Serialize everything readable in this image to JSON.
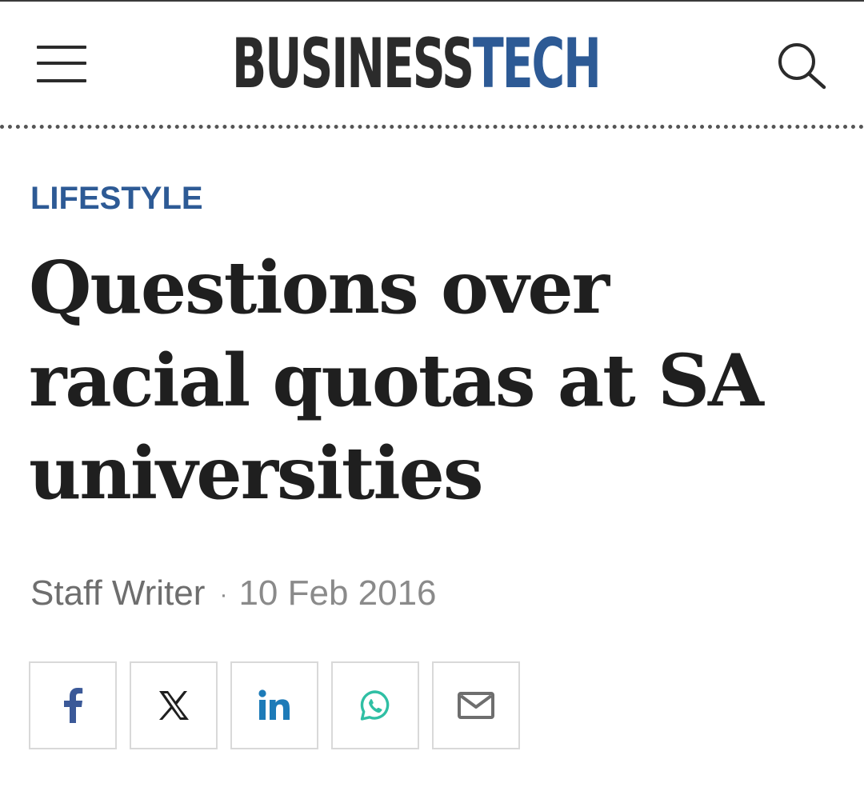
{
  "header": {
    "logo_part1": "BUSINESS",
    "logo_part2": "TECH",
    "menu_icon": "hamburger-menu-icon",
    "search_icon": "search-icon"
  },
  "article": {
    "category": "LIFESTYLE",
    "headline": "Questions over racial quotas at SA universities",
    "author": "Staff Writer",
    "separator": "·",
    "date": "10 Feb 2016"
  },
  "share": {
    "buttons": [
      {
        "icon": "facebook-icon",
        "color": "#3b5998"
      },
      {
        "icon": "x-twitter-icon",
        "color": "#1f1f1f"
      },
      {
        "icon": "linkedin-icon",
        "color": "#1d7bb8"
      },
      {
        "icon": "whatsapp-icon",
        "color": "#2fbfa4"
      },
      {
        "icon": "email-icon",
        "color": "#6e6e6e"
      }
    ]
  },
  "colors": {
    "brand_blue": "#2d5a95",
    "text_dark": "#1f1f1f",
    "text_muted": "#8a8a8a"
  }
}
